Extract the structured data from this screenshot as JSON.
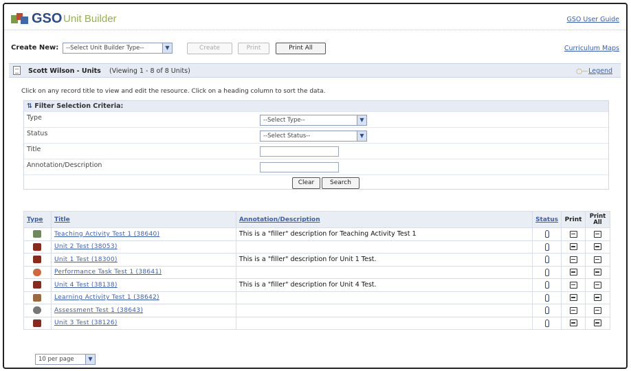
{
  "header": {
    "logo_gso": "GSO",
    "logo_rest": "Unit Builder",
    "user_guide": "GSO User Guide"
  },
  "toolbar": {
    "create_new_label": "Create New:",
    "type_select": "--Select Unit Builder Type--",
    "create_label": "Create",
    "print_label": "Print",
    "print_all_label": "Print All",
    "curriculum_maps": "Curriculum Maps"
  },
  "section": {
    "title": "Scott Wilson - Units",
    "viewing": "(Viewing 1 - 8 of 8 Units)",
    "legend": "Legend"
  },
  "instructions": "Click on any record title to view and edit the resource. Click on a heading column to sort the data.",
  "filter": {
    "title": "Filter Selection Criteria:",
    "rows": [
      {
        "label": "Type",
        "select": "--Select Type--"
      },
      {
        "label": "Status",
        "select": "--Select Status--"
      },
      {
        "label": "Title"
      },
      {
        "label": "Annotation/Description"
      }
    ],
    "clear_label": "Clear",
    "search_label": "Search"
  },
  "table": {
    "headers": {
      "type": "Type",
      "title": "Title",
      "description": "Annotation/Description",
      "status": "Status",
      "print": "Print",
      "print_all": "Print All"
    },
    "rows": [
      {
        "icon": "teaching-activity-icon",
        "title": "Teaching Activity Test 1   (38640)",
        "description": "This is a \"filler\" description for Teaching Activity Test 1"
      },
      {
        "icon": "unit-icon",
        "title": "Unit 2 Test   (38053)",
        "description": ""
      },
      {
        "icon": "unit-icon",
        "title": "Unit 1 Test   (18300)",
        "description": "This is a \"filler\" description for Unit 1 Test."
      },
      {
        "icon": "performance-task-icon",
        "title": "Performance Task Test 1   (38641)",
        "description": ""
      },
      {
        "icon": "unit-icon",
        "title": "Unit 4 Test   (38138)",
        "description": "This is a \"filler\" description for Unit 4 Test."
      },
      {
        "icon": "learning-activity-icon",
        "title": "Learning Activity Test 1   (38642)",
        "description": ""
      },
      {
        "icon": "assessment-icon",
        "title": "Assessment Test 1   (38643)",
        "description": ""
      },
      {
        "icon": "unit-icon",
        "title": "Unit 3 Test   (38126)",
        "description": ""
      }
    ]
  },
  "pagination": {
    "per_page": "10 per page"
  }
}
